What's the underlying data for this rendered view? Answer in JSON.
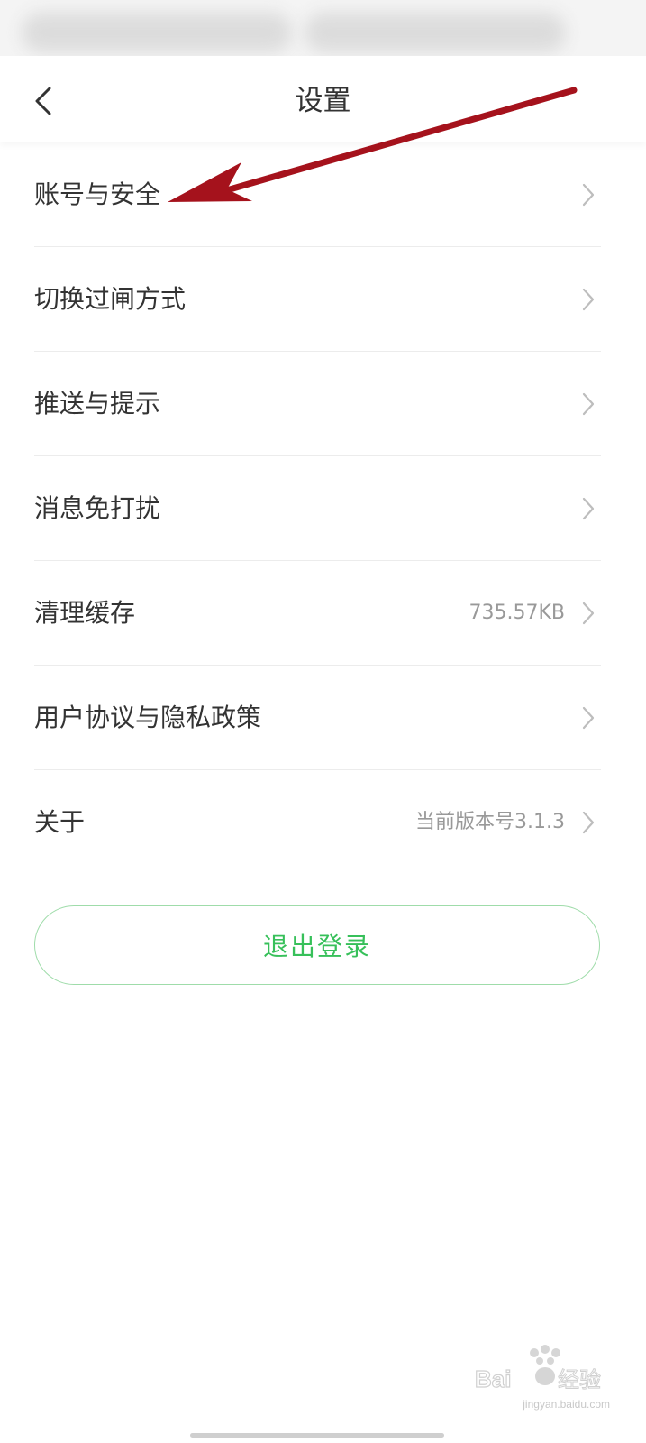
{
  "header": {
    "title": "设置",
    "back_icon": "chevron-left-icon"
  },
  "settings": [
    {
      "label": "账号与安全",
      "value": ""
    },
    {
      "label": "切换过闸方式",
      "value": ""
    },
    {
      "label": "推送与提示",
      "value": ""
    },
    {
      "label": "消息免打扰",
      "value": ""
    },
    {
      "label": "清理缓存",
      "value": "735.57KB"
    },
    {
      "label": "用户协议与隐私政策",
      "value": ""
    },
    {
      "label": "关于",
      "value": "当前版本号3.1.3"
    }
  ],
  "logout": {
    "label": "退出登录"
  },
  "watermark": {
    "brand": "Bai du 经验",
    "url": "jingyan.baidu.com"
  },
  "colors": {
    "accent_green": "#37c05a",
    "button_border": "#9fdcaa",
    "annotation_arrow": "#a5121c",
    "text_primary": "#333333",
    "text_secondary": "#999999"
  }
}
